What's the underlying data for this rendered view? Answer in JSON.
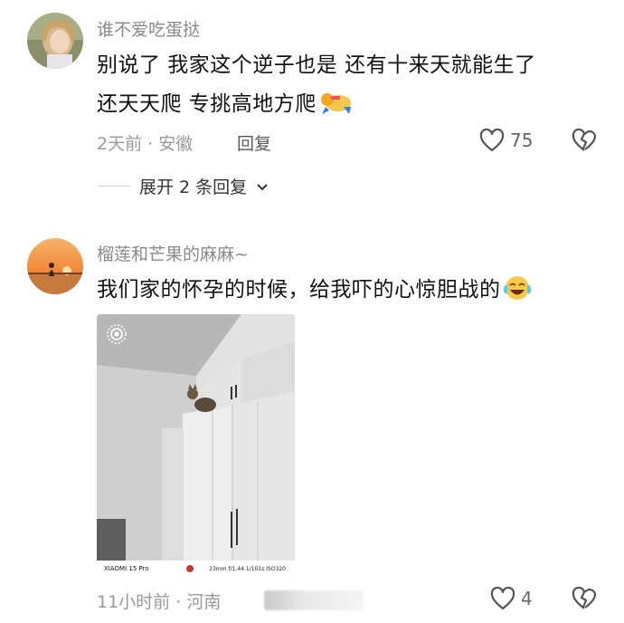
{
  "comments": [
    {
      "username": "谁不爱吃蛋挞",
      "text_line1": "别说了 我家这个逆子也是 还有十来天就能生了",
      "text_line2": "还天天爬 专挑高地方爬",
      "emoji": "cat-emoji",
      "time": "2天前",
      "location": "安徽",
      "reply_label": "回复",
      "likes": "75",
      "expand_label": "展开 2 条回复"
    },
    {
      "username": "榴莲和芒果的麻麻~",
      "text": "我们家的怀孕的时候，给我吓的心惊胆战的",
      "emoji": "crying-laughing-emoji",
      "photo": {
        "brand": "XIAOMI 15 Pro",
        "exif": "23mm  f/1.44  1/101s  ISO320"
      },
      "time": "11小时前",
      "location": "河南",
      "likes": "4"
    }
  ],
  "separator": "·",
  "colors": {
    "meta": "#9a9a9a",
    "username": "#8a8a8a",
    "text": "#111111"
  }
}
